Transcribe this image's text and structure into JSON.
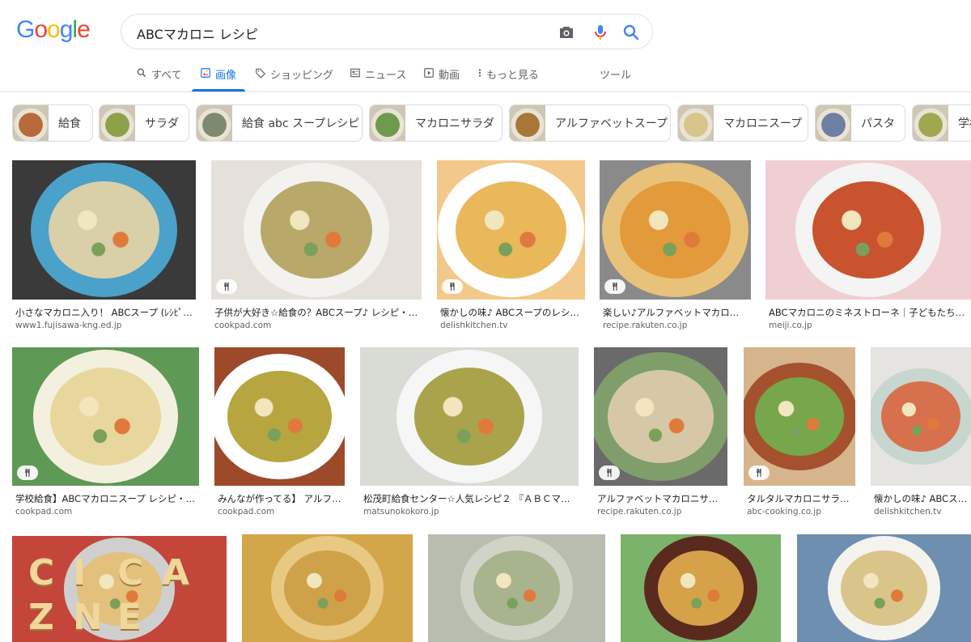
{
  "logo": {
    "letters": [
      "G",
      "o",
      "o",
      "g",
      "l",
      "e"
    ],
    "colors": [
      "#4285f4",
      "#ea4335",
      "#fbbc05",
      "#4285f4",
      "#34a853",
      "#ea4335"
    ]
  },
  "search": {
    "query": "ABCマカロニ レシピ"
  },
  "tabs": [
    {
      "label": "すべて",
      "icon": "search-icon"
    },
    {
      "label": "画像",
      "icon": "image-icon",
      "active": true
    },
    {
      "label": "ショッピング",
      "icon": "tag-icon"
    },
    {
      "label": "ニュース",
      "icon": "news-icon"
    },
    {
      "label": "動画",
      "icon": "play-icon"
    },
    {
      "label": "もっと見る",
      "icon": "more-vert-icon"
    },
    {
      "label": "ツール",
      "icon": ""
    }
  ],
  "chips": [
    {
      "label": "給食",
      "color": "#b86a3a"
    },
    {
      "label": "サラダ",
      "color": "#8fa04a"
    },
    {
      "label": "給食 abc スープレシピ",
      "color": "#7e8a70"
    },
    {
      "label": "マカロニサラダ",
      "color": "#6d9a4c"
    },
    {
      "label": "アルファベットスープ",
      "color": "#a9763a"
    },
    {
      "label": "マカロニスープ",
      "color": "#d8c58a"
    },
    {
      "label": "パスタ",
      "color": "#6d7fa3"
    },
    {
      "label": "学校",
      "color": "#9fa84e"
    }
  ],
  "results": [
    {
      "caption": "小さなマカロニ入り！ ABCスープ (ﾚｼﾋﾟ)…",
      "source": "www1.fujisawa-kng.ed.jp",
      "recipe": false,
      "bg": "#3a3a3a",
      "bowl": "#4aa1c9",
      "soup": "#d9cfa9"
    },
    {
      "caption": "子供が大好き☆給食の？ABCスープ♪ レシピ・…",
      "source": "cookpad.com",
      "recipe": true,
      "bg": "#e5e1da",
      "bowl": "#f4f2ee",
      "soup": "#b8a86a"
    },
    {
      "caption": "懐かしの味♪ ABCスープのレシ…",
      "source": "delishkitchen.tv",
      "recipe": true,
      "bg": "#f2c98a",
      "bowl": "#ffffff",
      "soup": "#e9b85a"
    },
    {
      "caption": "楽しい♪アルファベットマカロニ…",
      "source": "recipe.rakuten.co.jp",
      "recipe": true,
      "bg": "#8a8a8a",
      "bowl": "#e8c27a",
      "soup": "#e39a3a"
    },
    {
      "caption": "ABCマカロニのミネストローネ｜子どもたちが…",
      "source": "meiji.co.jp",
      "recipe": false,
      "bg": "#f0cfd3",
      "bowl": "#f4f4f4",
      "soup": "#c8532e"
    },
    {
      "caption": "学校給食】ABCマカロニスープ レシピ・…",
      "source": "cookpad.com",
      "recipe": true,
      "bg": "#5e9a55",
      "bowl": "#f3f0e0",
      "soup": "#e8d79c"
    },
    {
      "caption": "みんなが作ってる】 アルフ…",
      "source": "cookpad.com",
      "recipe": false,
      "bg": "#9c4a2a",
      "bowl": "#ffffff",
      "soup": "#b7a640"
    },
    {
      "caption": "松茂町給食センター☆人気レシピ２ 『ＡＢＣマ…",
      "source": "matsunokokoro.jp",
      "recipe": false,
      "bg": "#d8dcd4",
      "bowl": "#f6f6f6",
      "soup": "#a9a44c"
    },
    {
      "caption": "アルファベットマカロニサラ…",
      "source": "recipe.rakuten.co.jp",
      "recipe": true,
      "bg": "#6a6a6a",
      "bowl": "#7f9e6a",
      "soup": "#d6c8a6"
    },
    {
      "caption": "タルタルマカロニサラ…",
      "source": "abc-cooking.co.jp",
      "recipe": true,
      "bg": "#d6b58c",
      "bowl": "#a5512e",
      "soup": "#76a74a"
    },
    {
      "caption": "懐かしの味♪ ABCスープ",
      "source": "delishkitchen.tv",
      "recipe": false,
      "bg": "#e6e4e0",
      "bowl": "#c7d6cf",
      "soup": "#d7714d"
    },
    {
      "caption": "",
      "source": "",
      "recipe": false,
      "bg": "#c4453a",
      "bowl": "#cfcfcf",
      "soup": "#e3c17d"
    },
    {
      "caption": "",
      "source": "",
      "recipe": false,
      "bg": "#d4a64a",
      "bowl": "#e7c983",
      "soup": "#cfa24a"
    },
    {
      "caption": "",
      "source": "",
      "recipe": false,
      "bg": "#b9bdb0",
      "bowl": "#cfd4c6",
      "soup": "#a7b48e"
    },
    {
      "caption": "",
      "source": "",
      "recipe": false,
      "bg": "#7bb36a",
      "bowl": "#5a2a1f",
      "soup": "#d5a24a"
    },
    {
      "caption": "",
      "source": "",
      "recipe": false,
      "bg": "#6f8fb0",
      "bowl": "#f5f3ee",
      "soup": "#d9c58a"
    }
  ],
  "letters": [
    "C",
    "I",
    "C",
    "A",
    "Z",
    "N",
    "E"
  ]
}
